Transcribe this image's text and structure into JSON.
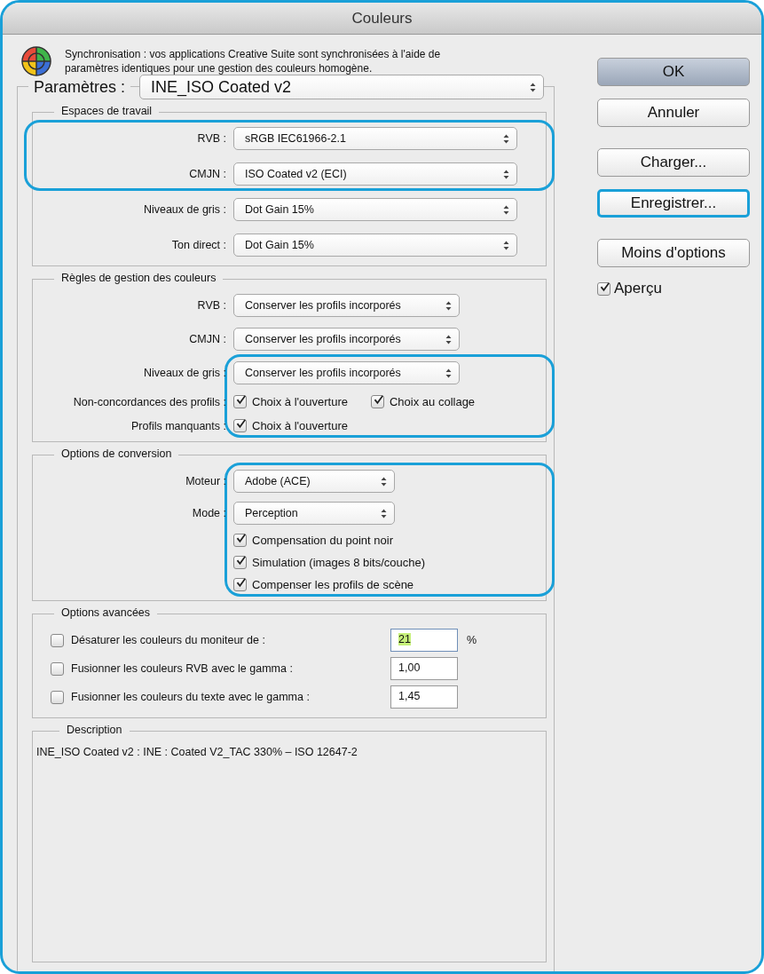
{
  "window": {
    "title": "Couleurs"
  },
  "sync_message": "Synchronisation : vos applications Creative Suite sont synchronisées à l'aide de paramètres identiques pour une gestion des couleurs homogène.",
  "settings": {
    "label": "Paramètres :",
    "value": "INE_ISO Coated v2"
  },
  "working_spaces": {
    "title": "Espaces de travail",
    "rows": [
      {
        "kind": "select",
        "label": "RVB :",
        "value": "sRGB IEC61966-2.1",
        "highlighted": true
      },
      {
        "kind": "select",
        "label": "CMJN :",
        "value": "ISO Coated v2 (ECI)",
        "highlighted": true
      },
      {
        "kind": "select",
        "label": "Niveaux de gris :",
        "value": "Dot Gain 15%",
        "highlighted": false
      },
      {
        "kind": "select",
        "label": "Ton direct :",
        "value": "Dot Gain 15%",
        "highlighted": false
      }
    ]
  },
  "policies": {
    "title": "Règles de gestion des couleurs",
    "rows": [
      {
        "kind": "select",
        "label": "RVB :",
        "value": "Conserver les profils incorporés",
        "highlighted": false
      },
      {
        "kind": "select",
        "label": "CMJN :",
        "value": "Conserver les profils incorporés",
        "highlighted": false
      },
      {
        "kind": "select",
        "label": "Niveaux de gris :",
        "value": "Conserver les profils incorporés",
        "highlighted": true
      },
      {
        "kind": "checks",
        "label": "Non-concordances des profils :",
        "checks": [
          {
            "label": "Choix à l'ouverture",
            "checked": true
          },
          {
            "label": "Choix au collage",
            "checked": true
          }
        ],
        "highlighted": true
      },
      {
        "kind": "checks",
        "label": "Profils manquants :",
        "checks": [
          {
            "label": "Choix à l'ouverture",
            "checked": true
          }
        ],
        "highlighted": true
      }
    ]
  },
  "conversion": {
    "title": "Options de conversion",
    "rows": [
      {
        "kind": "select",
        "label": "Moteur :",
        "value": "Adobe (ACE)",
        "highlighted": true
      },
      {
        "kind": "select",
        "label": "Mode :",
        "value": "Perception",
        "highlighted": true
      },
      {
        "kind": "checks",
        "checks": [
          {
            "label": "Compensation du point noir",
            "checked": true
          }
        ],
        "highlighted": true
      },
      {
        "kind": "checks",
        "checks": [
          {
            "label": "Simulation (images 8 bits/couche)",
            "checked": true
          }
        ],
        "highlighted": true
      },
      {
        "kind": "checks",
        "checks": [
          {
            "label": "Compenser les profils de scène",
            "checked": true
          }
        ],
        "highlighted": true
      }
    ]
  },
  "advanced": {
    "title": "Options avancées",
    "rows": [
      {
        "label": "Désaturer les couleurs du moniteur de :",
        "checked": false,
        "value": "21",
        "text_selected": true,
        "unit": "%"
      },
      {
        "label": "Fusionner les couleurs RVB avec le gamma :",
        "checked": false,
        "value": "1,00",
        "text_selected": false
      },
      {
        "label": "Fusionner les couleurs du texte avec le gamma :",
        "checked": false,
        "value": "1,45",
        "text_selected": false
      }
    ]
  },
  "description": {
    "title": "Description",
    "text": "INE_ISO Coated v2 :  INE : Coated V2_TAC 330% – ISO 12647-2"
  },
  "buttons": [
    {
      "label": "OK",
      "default": true,
      "highlighted": false
    },
    {
      "label": "Annuler",
      "default": false,
      "highlighted": false
    },
    {
      "label": "Charger...",
      "default": false,
      "highlighted": false
    },
    {
      "label": "Enregistrer...",
      "default": false,
      "highlighted": true
    },
    {
      "label": "Moins d'options",
      "default": false,
      "highlighted": false
    }
  ],
  "preview": {
    "label": "Aperçu",
    "checked": true
  }
}
